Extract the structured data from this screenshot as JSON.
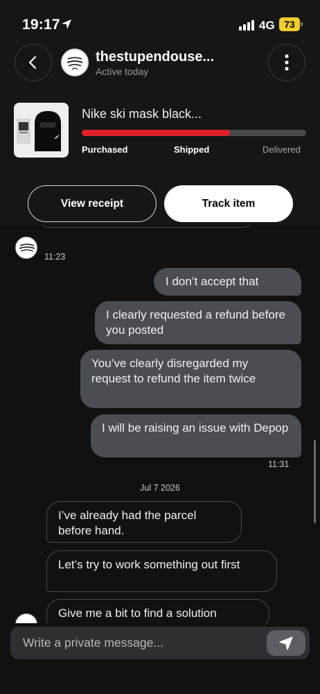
{
  "status": {
    "time": "19:17",
    "network": "4G",
    "battery": "73"
  },
  "header": {
    "username": "thestupendouse...",
    "presence": "Active today"
  },
  "order": {
    "title": "Nike ski mask black...",
    "progress": 0.66,
    "stages": [
      "Purchased",
      "Shipped",
      "Delivered"
    ],
    "view_receipt": "View receipt",
    "track_item": "Track item"
  },
  "chat": {
    "first_time": "11:23",
    "out_messages": [
      "I don’t accept that",
      "I clearly requested a refund before you posted",
      "You’ve clearly disregarded my request to refund the item twice",
      "I will be raising an issue with Depop"
    ],
    "out_time": "11:31",
    "date_divider": "Jul 7 2026",
    "in_messages": [
      "I’ve already had the parcel before hand.",
      "Let’s try to work something out first",
      "Give me a bit to find a solution"
    ]
  },
  "composer": {
    "placeholder": "Write a private message..."
  },
  "colors": {
    "progress": "#e0212a",
    "outgoing": "#4a4e53",
    "battery": "#f2cc2c"
  }
}
